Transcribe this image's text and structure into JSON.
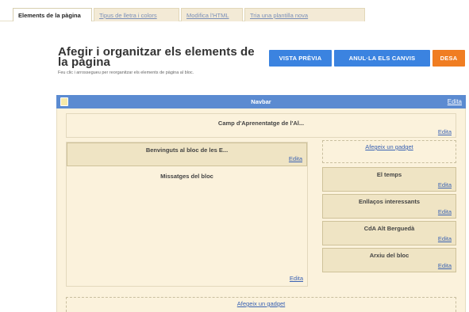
{
  "tabs": {
    "active": "Elements de la pàgina",
    "fonts": "Tipus de lletra i colors",
    "html": "Modifica l'HTML",
    "template": "Tria una plantilla nova"
  },
  "header": {
    "title": "Afegir i organitzar els elements de la pàgina",
    "subtitle": "Feu clic i arrossegueu per reorganitzar els elements de pàgina al bloc."
  },
  "actions": {
    "preview": "VISTA PRÈVIA",
    "revert": "ANUL·LA ELS CANVIS",
    "save": "DESA"
  },
  "navbar": {
    "label": "Navbar",
    "edit": "Edita"
  },
  "edit_label": "Edita",
  "layout": {
    "header_title": "Camp d'Aprenentatge de l'Al...",
    "welcome_title": "Benvinguts al bloc de les E...",
    "posts_title": "Missatges del bloc",
    "add_gadget": "Afegeix un gadget",
    "sidebar_gadgets": [
      "El temps",
      "Enllaços interessants",
      "CdA Alt Berguedà",
      "Arxiu del bloc"
    ]
  },
  "colors": {
    "accent_blue": "#3b83e0",
    "save_orange": "#f07d22",
    "navbar_blue": "#5b8bd1",
    "canvas_beige": "#fbf2dc",
    "widget_tan": "#efe4c4"
  }
}
